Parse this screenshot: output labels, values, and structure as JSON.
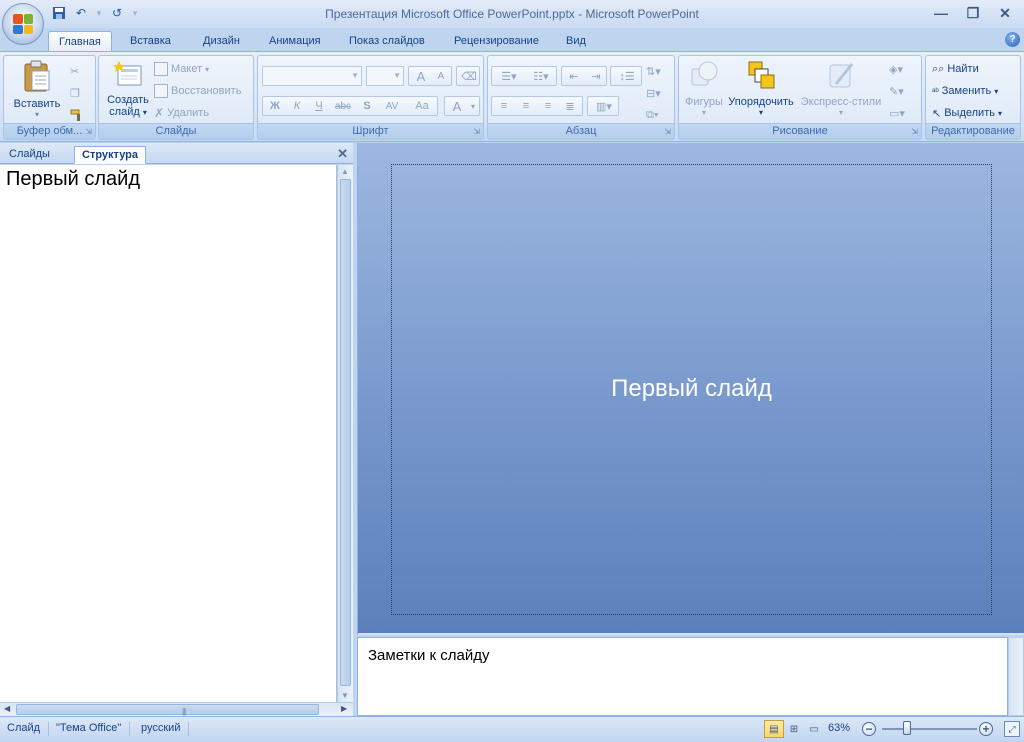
{
  "window": {
    "title": "Презентация Microsoft Office PowerPoint.pptx - Microsoft PowerPoint"
  },
  "ribbon": {
    "tabs": [
      {
        "label": "Главная",
        "active": true
      },
      {
        "label": "Вставка"
      },
      {
        "label": "Дизайн"
      },
      {
        "label": "Анимация"
      },
      {
        "label": "Показ слайдов"
      },
      {
        "label": "Рецензирование"
      },
      {
        "label": "Вид"
      }
    ],
    "clipboard": {
      "label": "Буфер обм...",
      "paste_label": "Вставить"
    },
    "slides": {
      "label": "Слайды",
      "new_slide_line1": "Создать",
      "new_slide_line2": "слайд",
      "layout_label": "Макет",
      "reset_label": "Восстановить",
      "delete_label": "Удалить"
    },
    "font": {
      "label": "Шрифт",
      "font_name_value": "",
      "font_size_value": "",
      "bold": "Ж",
      "italic": "К",
      "underline": "Ч",
      "strike": "abc",
      "shadow": "S",
      "spacing": "AV",
      "case": "Aa",
      "color": "A",
      "grow": "A",
      "shrink": "A"
    },
    "paragraph": {
      "label": "Абзац"
    },
    "drawing": {
      "label": "Рисование",
      "shapes_label": "Фигуры",
      "arrange_label": "Упорядочить",
      "quick_styles_label": "Экспресс-стили"
    },
    "editing": {
      "label": "Редактирование",
      "find_label": "Найти",
      "replace_label": "Заменить",
      "select_label": "Выделить"
    }
  },
  "left_pane": {
    "tab_slides": "Слайды",
    "tab_outline": "Структура",
    "outline_item": "Первый слайд"
  },
  "slide": {
    "title": "Первый слайд"
  },
  "notes": {
    "placeholder": "Заметки к слайду"
  },
  "status": {
    "slide": "Слайд",
    "theme": "\"Тема Office\"",
    "language": "русский",
    "zoom": "63%"
  },
  "colors": {
    "accent": "#15428b",
    "slide_top": "#9db8e0",
    "slide_bottom": "#5c80bb"
  }
}
